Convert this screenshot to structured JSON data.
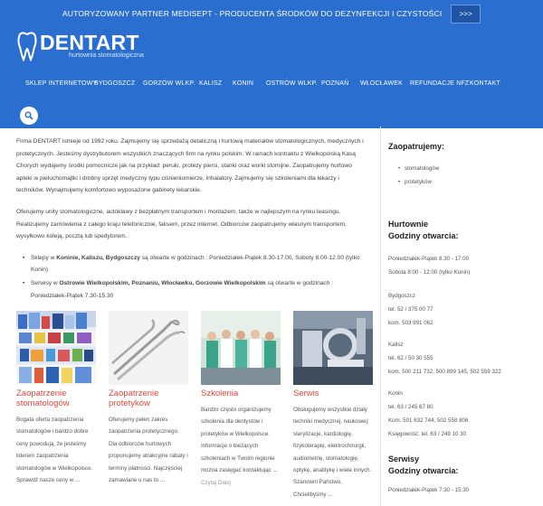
{
  "topbar": {
    "text": "AUTORYZOWANY PARTNER MEDISEPT - PRODUCENTA ŚRODKÓW DO DEZYNFEKCJI I CZYSTOŚCI",
    "button": ">>>"
  },
  "logo": {
    "name": "DENTART",
    "subtitle": "hurtownia stomatologiczna"
  },
  "nav": [
    "SKLEP INTERNETOWY",
    "BYDGOSZCZ",
    "GORZÓW WLKP.",
    "KALISZ",
    "KONIN",
    "OSTRÓW WLKP.",
    "POZNAŃ",
    "WŁOCŁAWEK",
    "REFUNDACJE NFZ",
    "KONTAKT"
  ],
  "main": {
    "para1": "Firma DENTART istnieje od 1992 roku. Zajmujemy się sprzedażą detaliczną i hurtową materiałów stomatologicznych, medycznych i protetycznych. Jesteśmy dystrybutorem wszystkich znaczących firm na rynku polskim. W ramach kontraktu z Wielkopolską Kasą Chorych wydajemy środki pomocnicze jak na przykład: peruki, protezy piersi, stanki oraz worki stomijne. Zaopatrujemy hurtowo apteki w pieluchomajtki i drobny sprzęt medyczny typu ciśnieniomierze, inhalatory. Zajmujemy się szkoleniami dla lekarzy i techników. Wynajmujemy komfortowo wyposażone gabinety lekarskie.",
    "para2": "Oferujemy unity stomatologiczne, autoklawy z bezpłatnym transportem i montażem, także w najlepszym na rynku leasingu. Realizujemy zamówienia z całego kraju telefonicznie, faksem, przez internet. Odbiorców zaopatrujemy własnym transportem, wysyłkowo koleją, pocztą lub spedytorem.",
    "bullet1_pre": "Sklepy w ",
    "bullet1_bold": "Koninie, Kaliszu, Bydgoszczy",
    "bullet1_post": " są otwarte w godzinach : Poniedziałek-Piątek 8.30-17.00, Soboty 8.00-12.00 (tylko Konin)",
    "bullet2_pre": "Serwisy w ",
    "bullet2_bold": "Ostrowie Wielkopolskim, Poznaniu, Włocławku, Gorzowie Wielkopolskim",
    "bullet2_post": " są otwarte w godzinach : Poniedziałek-Piątek 7.30-15.30"
  },
  "cards": [
    {
      "title": "Zaopatrzenie stomatologów",
      "text": "Bogata oferta zaopatrzenia stomatologów i bardzo dobre ceny powodują, że jesteśmy liderem zaopatrzenia stomatologów w Wielkopolsce. Sprawdź nasze ceny w ..."
    },
    {
      "title": "Zaopatrzenie protetyków",
      "text": "Oferujemy pełen zakres zaopatrzenia protetycznego. Dla odbiorców hurtowych proponujemy atrakcyjne rabaty i terminy płatności. Najczęściej zamawiane u nas to ..."
    },
    {
      "title": "Szkolenia",
      "text": "Bardzo często organizujemy szkolenia dla dentystów i protetyków w Wielkopolsce. Informacje o bieżących szkoleniach w Twoim regionie można zasięgać kontaktując ...",
      "more": "Czytaj Dalej"
    },
    {
      "title": "Serwis",
      "text": "Obsługujemy wszystkie działy techniki medycznej, naukowej: sterylizacje, kardiologię, fizykoterapię, elektrochirurgii, audiometrię, stomatologię, optykę, analitykę i wiele innych. Szanowni Państwo, Chcielibyśmy ..."
    }
  ],
  "sidebar": {
    "supply_title": "Zaopatrujemy:",
    "supply_items": [
      "stomatologów",
      "protetyków"
    ],
    "hurtownie_title": "Hurtownie",
    "hours_title": "Godziny otwarcia:",
    "hours1": "Poniedziałek-Piątek 8.30 - 17:00",
    "hours2": "Sobota 8:00 - 12:00 (tylko Konin)",
    "bydgoszcz": "Bydgoszcz",
    "bydgoszcz_tel": "tel. 52 / 375 00 77",
    "bydgoszcz_kom": "kom. 503 991 062",
    "kalisz": "Kalisz",
    "kalisz_tel": "tel. 62 / 50 30 555",
    "kalisz_kom": "kom. 500 211 732, 500 899 145, 502 559 322",
    "konin": "Konin",
    "konin_tel": "tel. 63 / 245 67 80",
    "konin_kom": "Kom. 501 632 744, 502 558 806",
    "konin_ksieg": "Księgowość: tel. 63 / 249 10 30",
    "serwisy_title": "Serwisy",
    "serwisy_hours_title": "Godziny otwarcia:",
    "serwisy_hours": "Poniedziałek-Piątek 7:30 - 15:30"
  },
  "colors": {
    "brand_blue": "#2a6fd0",
    "accent_red": "#e0473a"
  }
}
